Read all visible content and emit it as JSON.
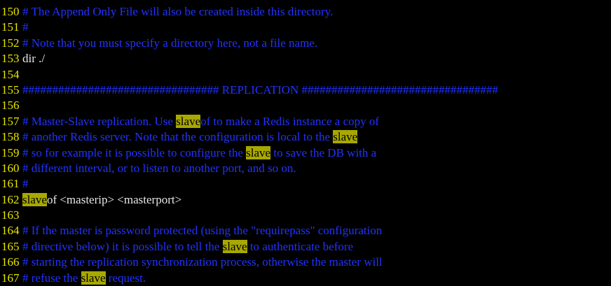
{
  "editor": {
    "colors": {
      "background": "#000000",
      "line_number": "#e6e600",
      "comment": "#2233ff",
      "normal_text": "#e8e8e8",
      "search_highlight_bg": "#a8a800",
      "search_highlight_fg": "#000000"
    },
    "search_term": "slave",
    "lines": [
      {
        "number": "150",
        "segments": [
          {
            "type": "comment",
            "text": "# The Append Only File will also be created inside this directory."
          }
        ]
      },
      {
        "number": "151",
        "segments": [
          {
            "type": "comment",
            "text": "#"
          }
        ]
      },
      {
        "number": "152",
        "segments": [
          {
            "type": "comment",
            "text": "# Note that you must specify a directory here, not a file name."
          }
        ]
      },
      {
        "number": "153",
        "segments": [
          {
            "type": "normal",
            "text": "dir ./"
          }
        ]
      },
      {
        "number": "154",
        "segments": []
      },
      {
        "number": "155",
        "segments": [
          {
            "type": "comment",
            "text": "################################# REPLICATION #################################"
          }
        ]
      },
      {
        "number": "156",
        "segments": []
      },
      {
        "number": "157",
        "segments": [
          {
            "type": "comment",
            "text": "# Master-Slave replication. Use "
          },
          {
            "type": "match",
            "text": "slave"
          },
          {
            "type": "comment",
            "text": "of to make a Redis instance a copy of"
          }
        ]
      },
      {
        "number": "158",
        "segments": [
          {
            "type": "comment",
            "text": "# another Redis server. Note that the configuration is local to the "
          },
          {
            "type": "match",
            "text": "slave"
          }
        ]
      },
      {
        "number": "159",
        "segments": [
          {
            "type": "comment",
            "text": "# so for example it is possible to configure the "
          },
          {
            "type": "match",
            "text": "slave"
          },
          {
            "type": "comment",
            "text": " to save the DB with a"
          }
        ]
      },
      {
        "number": "160",
        "segments": [
          {
            "type": "comment",
            "text": "# different interval, or to listen to another port, and so on."
          }
        ]
      },
      {
        "number": "161",
        "segments": [
          {
            "type": "comment",
            "text": "#"
          }
        ]
      },
      {
        "number": "162",
        "segments": [
          {
            "type": "match",
            "text": "slave"
          },
          {
            "type": "normal",
            "text": "of <masterip> <masterport>"
          }
        ]
      },
      {
        "number": "163",
        "segments": []
      },
      {
        "number": "164",
        "segments": [
          {
            "type": "comment",
            "text": "# If the master is password protected (using the \"requirepass\" configuration"
          }
        ]
      },
      {
        "number": "165",
        "segments": [
          {
            "type": "comment",
            "text": "# directive below) it is possible to tell the "
          },
          {
            "type": "match",
            "text": "slave"
          },
          {
            "type": "comment",
            "text": " to authenticate before"
          }
        ]
      },
      {
        "number": "166",
        "segments": [
          {
            "type": "comment",
            "text": "# starting the replication synchronization process, otherwise the master will"
          }
        ]
      },
      {
        "number": "167",
        "segments": [
          {
            "type": "comment",
            "text": "# refuse the "
          },
          {
            "type": "match",
            "text": "slave"
          },
          {
            "type": "comment",
            "text": " request."
          }
        ]
      }
    ]
  }
}
